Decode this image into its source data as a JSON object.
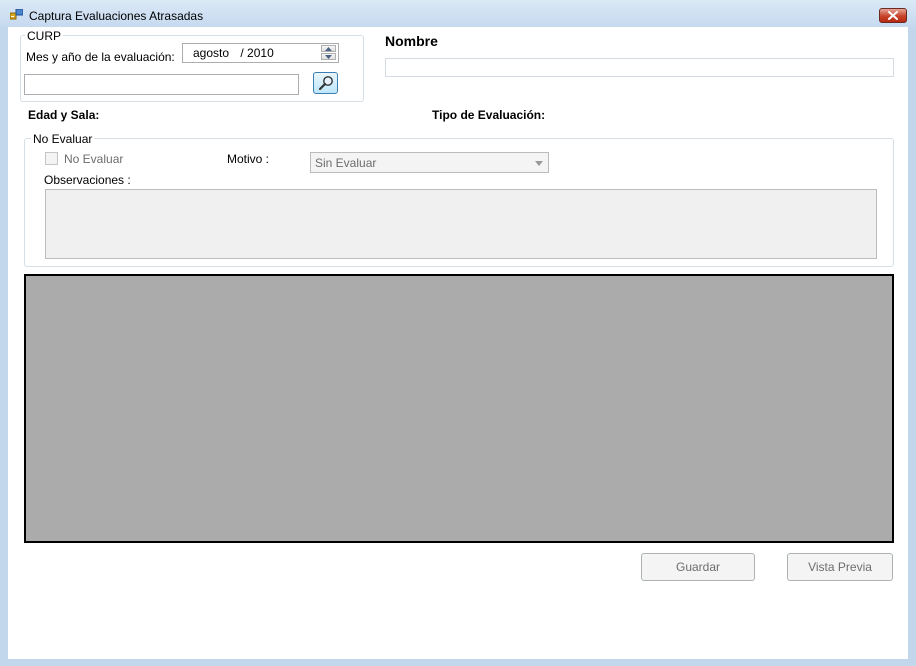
{
  "window": {
    "title": "Captura  Evaluaciones Atrasadas"
  },
  "curp_group": {
    "legend": "CURP",
    "month_year_label": "Mes y año de la evaluación:",
    "month_value": "agosto",
    "year_value": "/ 2010",
    "curp_value": ""
  },
  "nombre": {
    "label": "Nombre",
    "value": ""
  },
  "info": {
    "edad_sala_label": "Edad y Sala:",
    "tipo_evaluacion_label": "Tipo de Evaluación:"
  },
  "no_evaluar_group": {
    "legend": "No Evaluar",
    "checkbox_label": "No Evaluar",
    "checked": false,
    "motivo_label": "Motivo :",
    "motivo_selected": "Sin Evaluar",
    "observaciones_label": "Observaciones :",
    "observaciones_value": ""
  },
  "buttons": {
    "guardar": "Guardar",
    "vista_previa": "Vista Previa"
  },
  "icons": {
    "app": "app-window-icon",
    "close": "close-icon",
    "search": "magnifier-icon"
  },
  "colors": {
    "grid_bg": "#ababab",
    "title_gradient_top": "#dce9f7",
    "close_red": "#c7432a"
  }
}
